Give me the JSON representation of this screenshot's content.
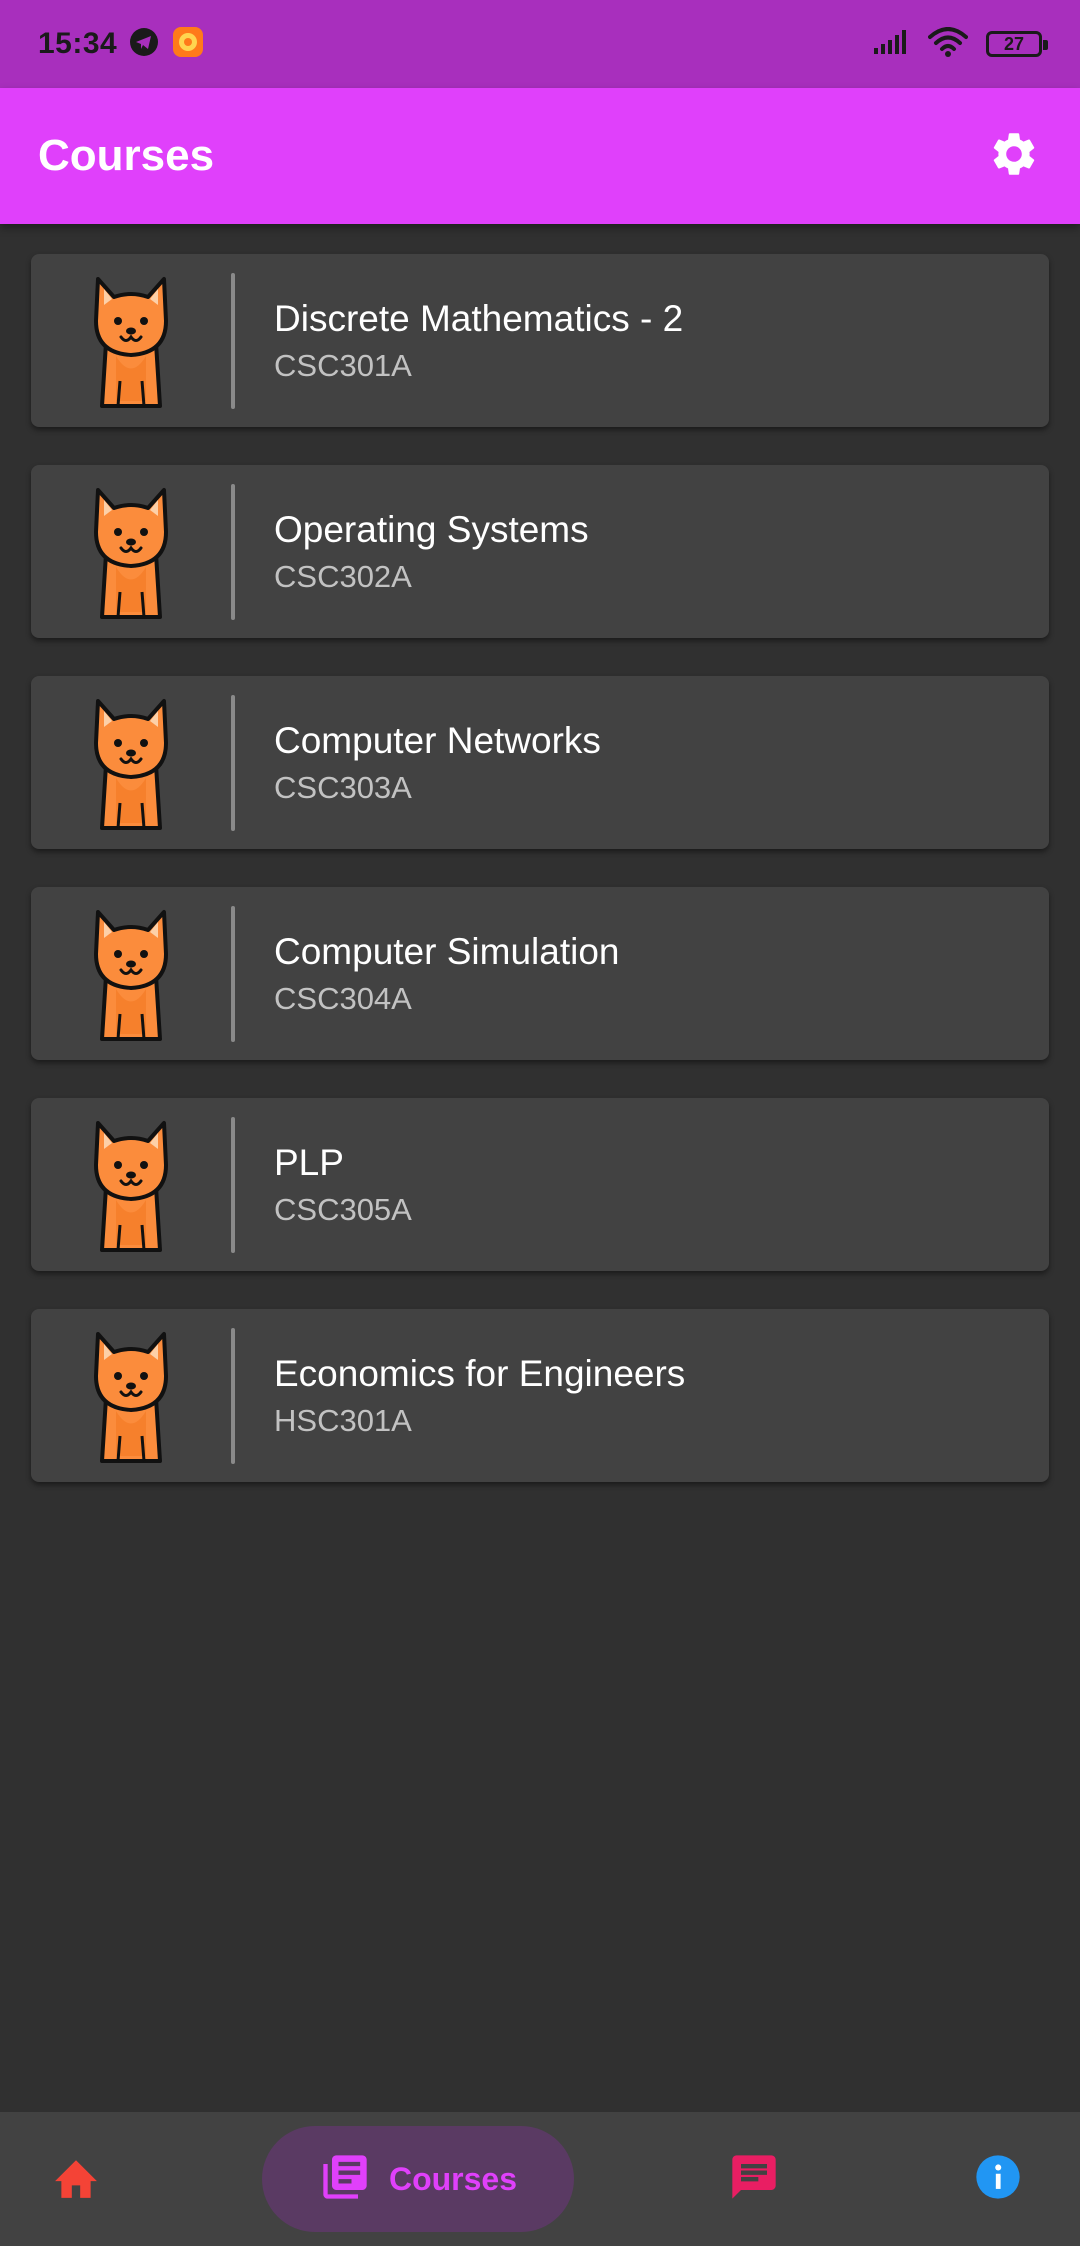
{
  "status_bar": {
    "time": "15:34",
    "battery": "27",
    "icons": [
      "telegram-icon",
      "app-notification-icon",
      "signal-icon",
      "wifi-icon",
      "battery-icon"
    ]
  },
  "app_bar": {
    "title": "Courses",
    "settings_icon": "gear-icon",
    "background": "#e040fb"
  },
  "courses": [
    {
      "name": "Discrete Mathematics - 2",
      "code": "CSC301A",
      "avatar": "cat-avatar-icon"
    },
    {
      "name": "Operating Systems",
      "code": "CSC302A",
      "avatar": "cat-avatar-icon"
    },
    {
      "name": "Computer Networks",
      "code": "CSC303A",
      "avatar": "cat-avatar-icon"
    },
    {
      "name": "Computer Simulation",
      "code": "CSC304A",
      "avatar": "cat-avatar-icon"
    },
    {
      "name": "PLP",
      "code": "CSC305A",
      "avatar": "cat-avatar-icon"
    },
    {
      "name": "Economics for Engineers",
      "code": "HSC301A",
      "avatar": "cat-avatar-icon"
    }
  ],
  "bottom_nav": {
    "items": [
      {
        "id": "home",
        "icon": "home-icon",
        "color": "#f44336"
      },
      {
        "id": "courses",
        "icon": "library-books-icon",
        "label": "Courses",
        "color": "#e040fb",
        "selected": true
      },
      {
        "id": "chat",
        "icon": "chat-icon",
        "color": "#e91e63"
      },
      {
        "id": "info",
        "icon": "info-icon",
        "color": "#2196f3"
      }
    ]
  },
  "colors": {
    "status_bar": "#a82fbd",
    "background": "#303030",
    "card": "#424242",
    "accent": "#e040fb"
  }
}
